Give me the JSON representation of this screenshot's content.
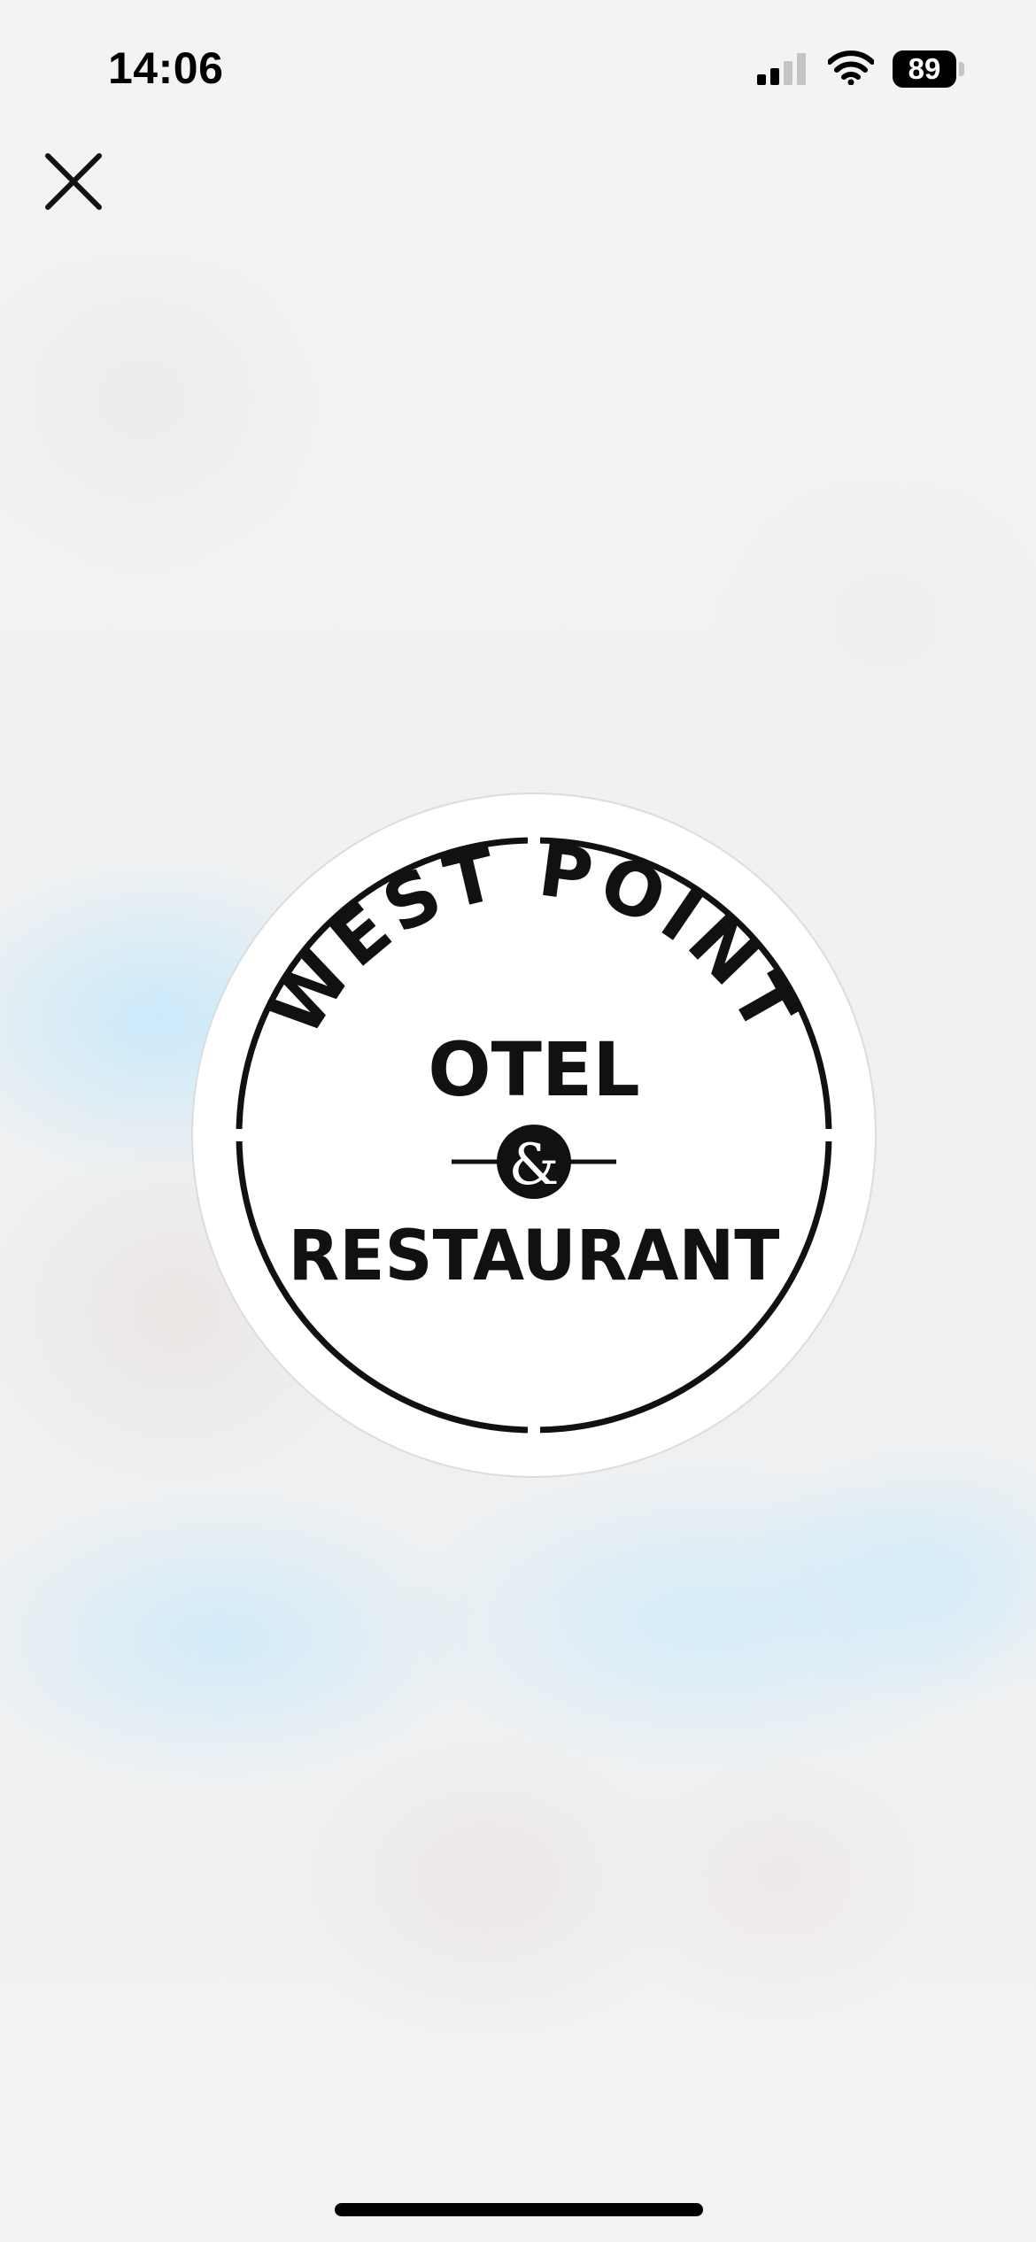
{
  "status_bar": {
    "time": "14:06",
    "battery_level": "89",
    "signal_bars_active": 2,
    "signal_bars_total": 4,
    "icons": [
      "signal-icon",
      "wifi-icon",
      "battery-icon"
    ]
  },
  "toolbar": {
    "close_icon": "close-icon"
  },
  "logo": {
    "arc_text": "WEST POINT",
    "line1": "OTEL",
    "ampersand": "&",
    "line2": "RESTAURANT"
  },
  "colors": {
    "background": "#f1f2f3",
    "logo_ink": "#111111",
    "logo_disc": "#ffffff"
  }
}
